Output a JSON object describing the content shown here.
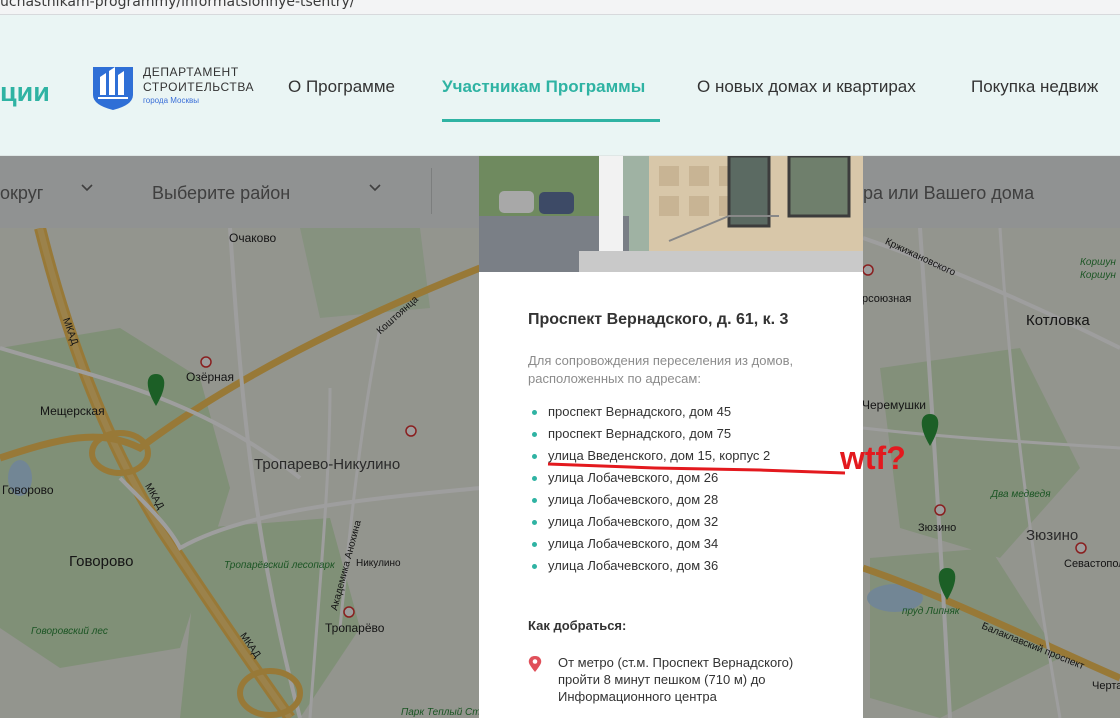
{
  "browser": {
    "url": "uchastnikam-programmy/informatsionnye-tsentry/"
  },
  "header": {
    "logo_partial": "ции",
    "dept_logo": {
      "line1": "ДЕПАРТАМЕНТ",
      "line2": "СТРОИТЕЛЬСТВА",
      "line3": "города Москвы"
    },
    "nav": [
      {
        "label": "О Программе",
        "active": false
      },
      {
        "label": "Участникам Программы",
        "active": true
      },
      {
        "label": "О новых домах и квартирах",
        "active": false
      },
      {
        "label": "Покупка недвиж",
        "active": false
      }
    ],
    "accent": "#2fb3a3"
  },
  "filters": {
    "okrug": "округ",
    "district": "Выберите район",
    "search": "ра или Вашего дома"
  },
  "map": {
    "labels": {
      "ochakovo": "Очаково",
      "ozernaya": "Озёрная",
      "meshcherskaya": "Мещерская",
      "govorovo_station": "Говорово",
      "govorovo": "Говорово",
      "troparevo_nikulino": "Тропарево-Никулино",
      "troparevo": "Тропарёво",
      "nikulino": "Никулино",
      "koshtoyantsa": "Коштоянца",
      "mkad1": "МКАД",
      "mkad2": "МКАД",
      "mkad3": "МКАД",
      "akademika_anokhina": "Академика Анохина",
      "troparevsky_lesopark": "Тропарёвский лесопарк",
      "govorovsky_les": "Говоровский лес",
      "park_teply_stan": "Парк Теплый Стан",
      "kotlovka": "Котловка",
      "cheremushki": "Черемушки",
      "zyuzino_station": "Зюзино",
      "zyuzino": "Зюзино",
      "sevastopolskaya": "Севастопольская",
      "dva_medvedya": "Два медведя",
      "prud_lipnyak": "пруд Липняк",
      "balaklavsky": "Балаклавский проспект",
      "krzhizhanovskogo": "Кржижановского",
      "korshun": "Коршун",
      "korshun2": "Коршун",
      "krsosyuzna": "рсоюзная",
      "chertanovo": "Черта"
    }
  },
  "card": {
    "title": "Проспект Вернадского, д. 61, к. 3",
    "subtitle": "Для сопровождения переселения из домов, расположенных по адресам:",
    "addresses": [
      "проспект Вернадского, дом 45",
      "проспект Вернадского, дом 75",
      "улица Введенского, дом 15, корпус 2",
      "улица Лобачевского, дом 26",
      "улица Лобачевского, дом 28",
      "улица Лобачевского, дом 32",
      "улица Лобачевского, дом 34",
      "улица Лобачевского, дом 36"
    ],
    "howto_title": "Как добраться:",
    "howto_text": "От метро (ст.м. Проспект Вернадского) пройти 8 минут пешком (710 м) до Информационного центра"
  },
  "annotation": {
    "text": "wtf?",
    "color": "#e3191e"
  }
}
